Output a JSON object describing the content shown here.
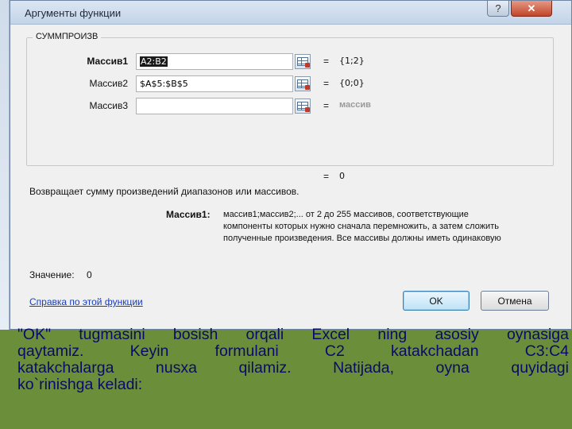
{
  "window": {
    "title": "Аргументы функции",
    "help_button": "?",
    "close_button": "✕"
  },
  "function": {
    "name": "СУММПРОИЗВ",
    "args": [
      {
        "label": "Массив1",
        "value": "A2:B2",
        "result": "{1;2}"
      },
      {
        "label": "Массив2",
        "value": "$A$5:$B$5",
        "result": "{0;0}"
      },
      {
        "label": "Массив3",
        "value": "",
        "result": "массив"
      }
    ],
    "equals": "=",
    "result": "0",
    "description": "Возвращает сумму произведений диапазонов или массивов.",
    "arg_help_name": "Массив1:",
    "arg_help_lines": [
      "массив1;массив2;... от 2 до 255 массивов, соответствующие",
      "компоненты которых нужно сначала перемножить, а затем сложить",
      "полученные произведения. Все массивы должны иметь одинаковую"
    ]
  },
  "footer": {
    "value_label": "Значение:",
    "value": "0",
    "help_link": "Справка по этой функции",
    "ok_label": "OK",
    "cancel_label": "Отмена"
  },
  "caption": {
    "lines": [
      "\"OK\" tugmasini bosish orqali Excel ning asosiy oynasiga",
      "qaytamiz. Keyin formulani C2 katakchadan C3:C4",
      "katakchalarga nusxa qilamiz. Natijada, oyna quyidagi",
      "ko`rinishga keladi:"
    ]
  },
  "colors": {
    "slide_background": "#6b8e3a",
    "caption_text": "#0a0a6a",
    "link": "#1a3db5"
  }
}
